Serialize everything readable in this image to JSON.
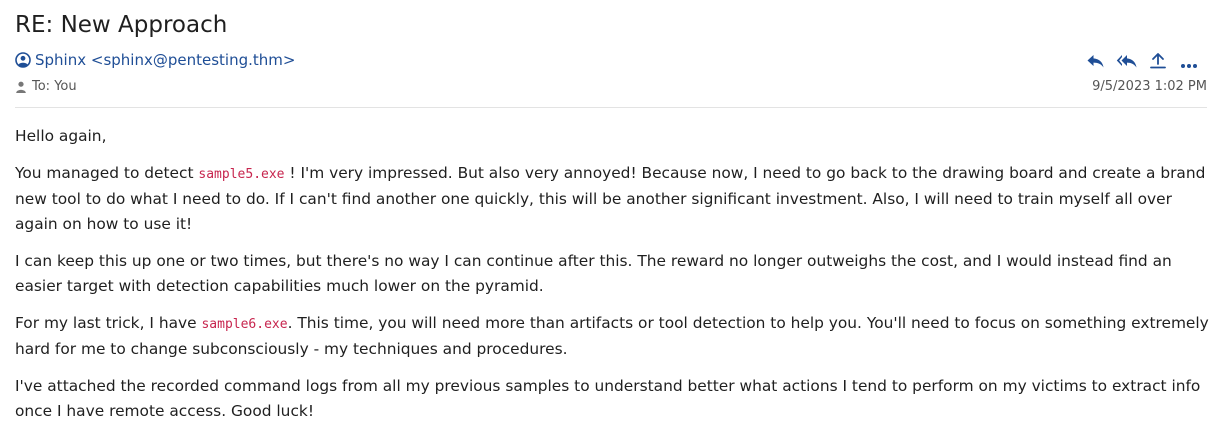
{
  "email": {
    "subject": "RE: New Approach",
    "from": "Sphinx <sphinx@pentesting.thm>",
    "to": "To: You",
    "date": "9/5/2023 1:02 PM",
    "actions": {
      "reply": "reply-icon",
      "reply_all": "reply-all-icon",
      "forward": "forward-icon",
      "more": "more-icon"
    },
    "body": {
      "greeting": "Hello again,",
      "p1_before": "You managed to detect ",
      "p1_code": "sample5.exe",
      "p1_after": " ! I'm very impressed. But also very annoyed! Because now, I need to go back to the drawing board and create a brand new tool to do what I need to do. If I can't find another one quickly, this will be another significant investment. Also, I will need to train myself all over again on how to use it!",
      "p2": "I can keep this up one or two times, but there's no way I can continue after this. The reward no longer outweighs the cost, and I would instead find an easier target with detection capabilities much lower on the pyramid.",
      "p3_before": "For my last trick, I have ",
      "p3_code": "sample6.exe",
      "p3_after": ". This time, you will need more than artifacts or tool detection to help you. You'll need to focus on something extremely hard for me to change subconsciously - my techniques and procedures.",
      "p4": "I've attached the recorded command logs from all my previous samples to understand better what actions I tend to perform on my victims to extract info once I have remote access. Good luck!"
    }
  },
  "colors": {
    "link": "#1f4e96",
    "code": "#c7254e",
    "text": "#1f1f1f",
    "muted": "#555555"
  }
}
